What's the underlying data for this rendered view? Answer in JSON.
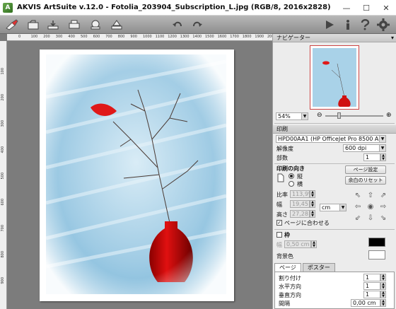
{
  "window": {
    "title": "AKVIS ArtSuite v.12.0 - Fotolia_203904_Subscription_L.jpg (RGB/8, 2016x2828)",
    "minimize": "—",
    "maximize": "☐",
    "close": "✕"
  },
  "toolbar": {
    "icons": [
      "brush-icon",
      "open-icon",
      "save-icon",
      "print-icon",
      "share-icon",
      "batch-icon",
      "undo-icon",
      "redo-icon",
      "run-icon",
      "info-icon",
      "help-icon",
      "settings-icon"
    ]
  },
  "ruler": {
    "h": [
      "0",
      "100",
      "200",
      "300",
      "400",
      "500",
      "600",
      "700",
      "800",
      "900",
      "1000",
      "1100",
      "1200",
      "1300",
      "1400",
      "1500",
      "1600",
      "1700",
      "1800",
      "1900",
      "2000"
    ],
    "v": [
      "100",
      "200",
      "300",
      "400",
      "500",
      "600",
      "700",
      "800",
      "900"
    ]
  },
  "navigator": {
    "title": "ナビゲーター",
    "zoom": "54%"
  },
  "print": {
    "section_title": "印刷",
    "printer": "HPD00AA1 (HP OfficeJet Pro 8500 A910)",
    "resolution_label": "解像度",
    "resolution_value": "600 dpi",
    "copies_label": "部数",
    "copies_value": "1",
    "orientation_title": "印刷の向き",
    "portrait": "縦",
    "landscape": "横",
    "page_setup_btn": "ページ設定",
    "reset_margins_btn": "余白のリセット",
    "ratio_label": "比率",
    "ratio_value": "113,9%",
    "width_label": "幅",
    "width_value": "19,45",
    "height_label": "高さ",
    "height_value": "27,28",
    "unit": "cm",
    "fit_page": "ページに合わせる",
    "frame_label": "枠",
    "frame_width_label": "幅",
    "frame_width_value": "0,50 cm",
    "bg_color_label": "背景色",
    "frame_color": "#000000",
    "bg_color": "#ffffff"
  },
  "tabs": [
    "ページ",
    "ポスター"
  ],
  "page_tab": {
    "cut_label": "割り付け",
    "cut_value": "1",
    "horiz_label": "水平方向",
    "horiz_value": "1",
    "vert_label": "垂直方向",
    "vert_value": "1",
    "spacing_label": "間隔",
    "spacing_value": "0,00 cm"
  }
}
